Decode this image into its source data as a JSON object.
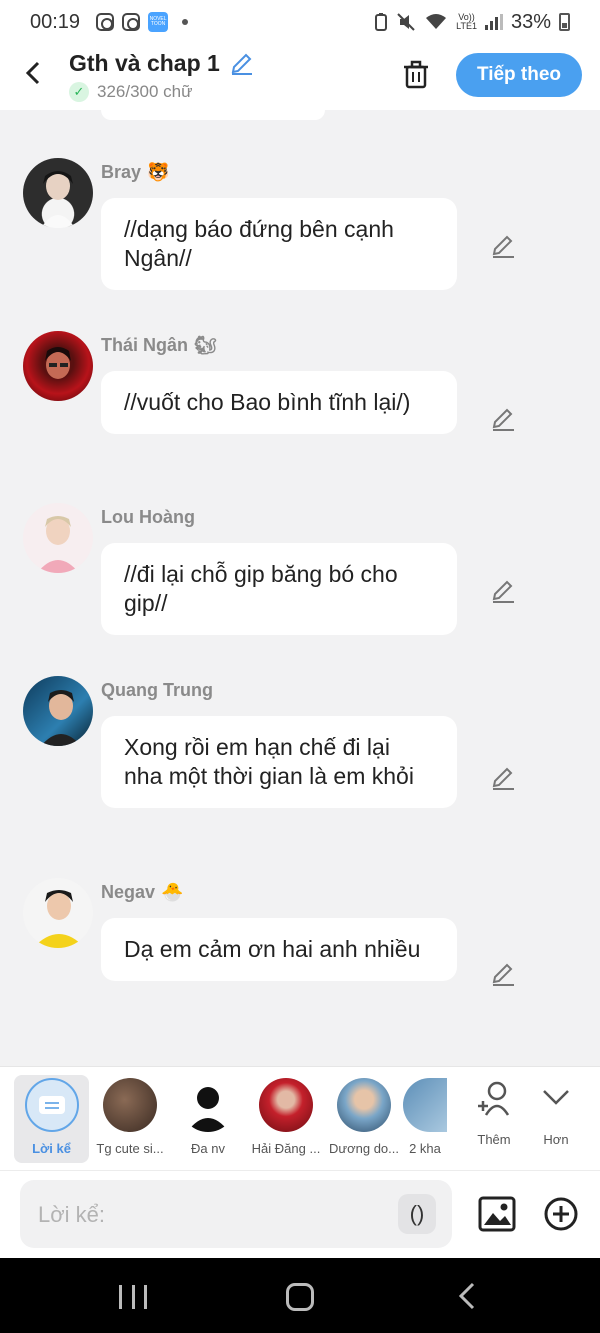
{
  "status_bar": {
    "time": "00:19",
    "app_badge": "NOVEL TOON",
    "network_top": "Vo))",
    "network_bottom": "LTE1",
    "battery": "33%"
  },
  "header": {
    "back_icon": "chevron-left-icon",
    "title": "Gth và chap 1",
    "word_count": "326/300 chữ",
    "next_button": "Tiếp theo"
  },
  "messages": [
    {
      "sender": "Bray",
      "emoji": "🐯",
      "text": "//dạng báo đứng bên cạnh Ngân//"
    },
    {
      "sender": "Thái Ngân",
      "emoji": "🐿",
      "text": "//vuốt cho Bao bình tĩnh lại/)"
    },
    {
      "sender": "Lou Hoàng",
      "emoji": "",
      "text": "//đi lại chỗ gip băng bó cho gip//"
    },
    {
      "sender": "Quang Trung",
      "emoji": "",
      "text": "Xong rồi em hạn chế đi lại nha một thời gian là em khỏi"
    },
    {
      "sender": "Negav",
      "emoji": "🐣",
      "text": "Dạ em cảm ơn hai anh nhiều"
    }
  ],
  "characters": [
    {
      "label": "Lời kể"
    },
    {
      "label": "Tg cute si..."
    },
    {
      "label": "Đa nv"
    },
    {
      "label": "Hải Đăng ..."
    },
    {
      "label": "Dương do..."
    },
    {
      "label": "2 kha"
    }
  ],
  "more_actions": {
    "add": "Thêm",
    "more": "Hơn"
  },
  "composer": {
    "placeholder": "Lời kể:",
    "paren": "()"
  }
}
